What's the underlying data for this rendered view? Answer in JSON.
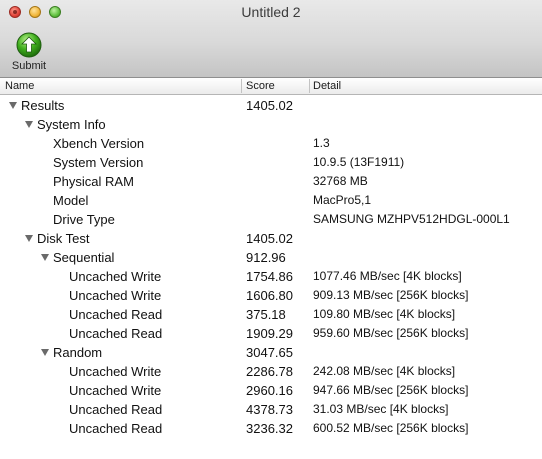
{
  "window": {
    "title": "Untitled 2"
  },
  "toolbar": {
    "submit_label": "Submit",
    "submit_icon": "green-up-arrow-icon"
  },
  "columns": {
    "name": "Name",
    "score": "Score",
    "detail": "Detail"
  },
  "rows": [
    {
      "name": "Results",
      "score": "1405.02",
      "detail": "",
      "level": 0,
      "expanded": true
    },
    {
      "name": "System Info",
      "score": "",
      "detail": "",
      "level": 1,
      "expanded": true
    },
    {
      "name": "Xbench Version",
      "score": "",
      "detail": "1.3",
      "level": 2
    },
    {
      "name": "System Version",
      "score": "",
      "detail": "10.9.5 (13F1911)",
      "level": 2
    },
    {
      "name": "Physical RAM",
      "score": "",
      "detail": "32768 MB",
      "level": 2
    },
    {
      "name": "Model",
      "score": "",
      "detail": "MacPro5,1",
      "level": 2
    },
    {
      "name": "Drive Type",
      "score": "",
      "detail": "SAMSUNG MZHPV512HDGL-000L1",
      "level": 2
    },
    {
      "name": "Disk Test",
      "score": "1405.02",
      "detail": "",
      "level": 1,
      "expanded": true
    },
    {
      "name": "Sequential",
      "score": "912.96",
      "detail": "",
      "level": 2,
      "expanded": true
    },
    {
      "name": "Uncached Write",
      "score": "1754.86",
      "detail": "1077.46 MB/sec [4K blocks]",
      "level": 3
    },
    {
      "name": "Uncached Write",
      "score": "1606.80",
      "detail": "909.13 MB/sec [256K blocks]",
      "level": 3
    },
    {
      "name": "Uncached Read",
      "score": "375.18",
      "detail": "109.80 MB/sec [4K blocks]",
      "level": 3
    },
    {
      "name": "Uncached Read",
      "score": "1909.29",
      "detail": "959.60 MB/sec [256K blocks]",
      "level": 3
    },
    {
      "name": "Random",
      "score": "3047.65",
      "detail": "",
      "level": 2,
      "expanded": true
    },
    {
      "name": "Uncached Write",
      "score": "2286.78",
      "detail": "242.08 MB/sec [4K blocks]",
      "level": 3
    },
    {
      "name": "Uncached Write",
      "score": "2960.16",
      "detail": "947.66 MB/sec [256K blocks]",
      "level": 3
    },
    {
      "name": "Uncached Read",
      "score": "4378.73",
      "detail": "31.03 MB/sec [4K blocks]",
      "level": 3
    },
    {
      "name": "Uncached Read",
      "score": "3236.32",
      "detail": "600.52 MB/sec [256K blocks]",
      "level": 3
    }
  ]
}
